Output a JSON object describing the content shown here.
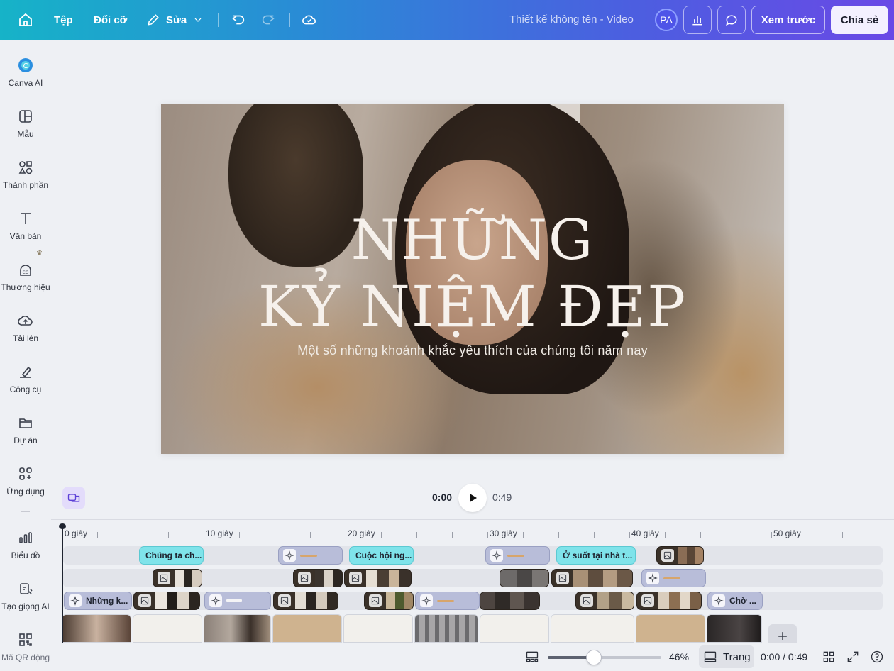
{
  "topbar": {
    "file_label": "Tệp",
    "resize_label": "Đổi cỡ",
    "edit_label": "Sửa",
    "doc_title": "Thiết kế không tên - Video",
    "avatar_initials": "PA",
    "preview_label": "Xem trước",
    "share_label": "Chia sẻ"
  },
  "sidebar": {
    "items": [
      {
        "label": "Canva AI",
        "icon": "canva-ai-icon"
      },
      {
        "label": "Mẫu",
        "icon": "templates-icon"
      },
      {
        "label": "Thành phần",
        "icon": "elements-icon"
      },
      {
        "label": "Văn bản",
        "icon": "text-icon"
      },
      {
        "label": "Thương hiệu",
        "icon": "brand-icon"
      },
      {
        "label": "Tải lên",
        "icon": "upload-icon"
      },
      {
        "label": "Công cụ",
        "icon": "tools-icon"
      },
      {
        "label": "Dự án",
        "icon": "folder-icon"
      },
      {
        "label": "Ứng dụng",
        "icon": "apps-icon"
      },
      {
        "label": "Biểu đồ",
        "icon": "chart-icon"
      },
      {
        "label": "Tạo giọng AI",
        "icon": "ai-voice-icon"
      },
      {
        "label": "Mã QR động",
        "icon": "qr-code-icon"
      }
    ]
  },
  "canvas": {
    "title_line1": "NHỮNG",
    "title_line2": "KỶ NIỆM ĐẸP",
    "subtitle": "Một số những khoảnh khắc yêu thích của chúng tôi năm nay"
  },
  "playback": {
    "current_time": "0:00",
    "total_time": "0:49"
  },
  "timeline": {
    "ruler": [
      "0 giây",
      "10 giây",
      "20 giây",
      "30 giây",
      "40 giây",
      "50 giây"
    ],
    "text_clips": [
      "Chúng ta ch...",
      "Cuộc hội ng...",
      "Ở suốt tại nhà t..."
    ],
    "anim_clips": [
      "Những k...",
      "Chờ ..."
    ]
  },
  "bottombar": {
    "zoom_percent": "46%",
    "zoom_fraction": 0.46,
    "pages_label": "Trang",
    "time_display": "0:00 / 0:49"
  },
  "colors": {
    "topbar_start": "#16b3c8",
    "topbar_end": "#6a49e6",
    "text_clip": "#7fe3ea",
    "anim_clip": "#b8bdd9"
  }
}
